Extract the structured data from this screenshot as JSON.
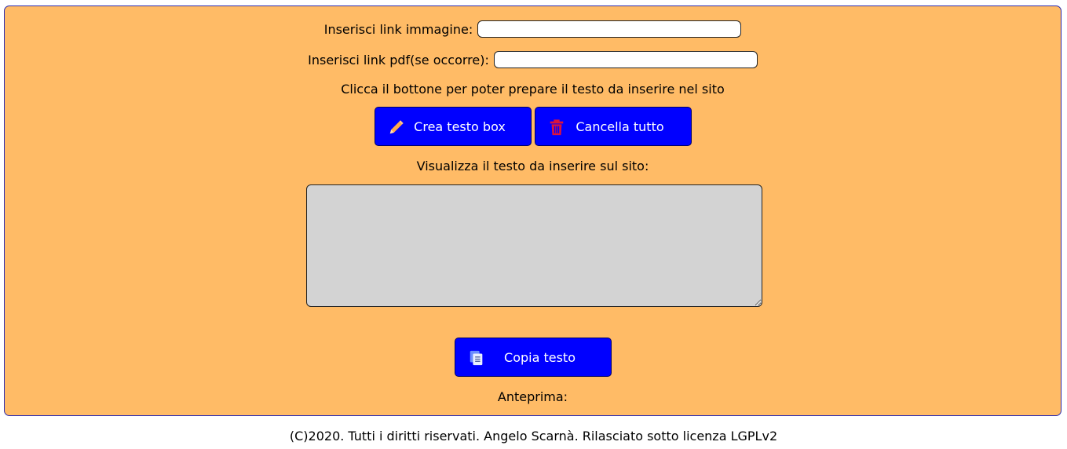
{
  "form": {
    "image_link_label": "Inserisci link immagine:",
    "image_link_value": "",
    "pdf_link_label": "Inserisci link pdf(se occorre):",
    "pdf_link_value": "",
    "instruction": "Clicca il bottone per poter prepare il testo da inserire nel sito",
    "create_button_label": "Crea testo box",
    "create_button_icon": "pencil-icon",
    "clear_button_label": "Cancella tutto",
    "clear_button_icon": "trash-icon",
    "output_label": "Visualizza il testo da inserire sul sito:",
    "output_value": "",
    "copy_button_label": "Copia testo",
    "copy_button_icon": "copy-icon",
    "preview_label": "Anteprima:"
  },
  "footer": {
    "text": "(C)2020. Tutti i diritti riservati. Angelo Scarnà. Rilasciato sotto licenza LGPLv2"
  },
  "colors": {
    "panel_background": "#ffbb66",
    "button_background": "#0000ff",
    "button_text": "#ffffff",
    "textarea_background": "#d3d3d3",
    "trash_icon": "#dc143c",
    "pencil_icon": "#ffa94d"
  }
}
